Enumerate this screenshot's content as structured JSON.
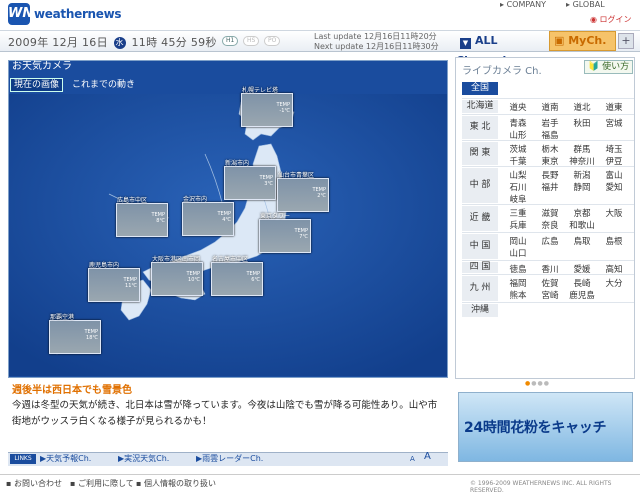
{
  "brand": {
    "logo": "WN",
    "name": "weathernews"
  },
  "top_links": {
    "company": "COMPANY",
    "global": "GLOBAL",
    "login": "ログイン"
  },
  "datebar": {
    "date": "2009年 12月 16日",
    "dow": "水",
    "time": "11時 45分 59秒",
    "pills": [
      "H1",
      "HS",
      "PO"
    ],
    "last_update": "Last update 12月16日11時20分",
    "next_update": "Next update 12月16日11時30分"
  },
  "nav": {
    "all_channel": "ALL Channel",
    "mych": "MyCh.",
    "plus": "+"
  },
  "left": {
    "title": "お天気カメラ",
    "tab_now": "現在の画像",
    "tab_past": "これまでの動き"
  },
  "cameras": [
    {
      "label": "札幌テレビ塔",
      "temp": "TEMP\n-1℃"
    },
    {
      "label": "新潟市内",
      "temp": "TEMP\n3℃"
    },
    {
      "label": "仙台市青葉区",
      "temp": "TEMP\n2℃"
    },
    {
      "label": "広島市中区",
      "temp": "TEMP\n8℃"
    },
    {
      "label": "金沢市内",
      "temp": "TEMP\n4℃"
    },
    {
      "label": "東京タワー",
      "temp": "TEMP\n7℃"
    },
    {
      "label": "大阪市港区南市岡",
      "temp": "TEMP\n10℃"
    },
    {
      "label": "名古屋市中区",
      "temp": "TEMP\n6℃"
    },
    {
      "label": "鹿児島市内",
      "temp": "TEMP\n11℃"
    },
    {
      "label": "那覇空港",
      "temp": "TEMP\n18℃"
    }
  ],
  "headline": "週後半は西日本でも雪景色",
  "desc": "今週は冬型の天気が続き、北日本は雪が降っています。今夜は山陰でも雪が降る可能性あり。山や市街地がウッスラ白くなる様子が見られるかも！",
  "links": {
    "tag": "LINKS",
    "items": [
      "天気予報Ch.",
      "実況天気Ch.",
      "雨雲レーダーCh."
    ],
    "fontA": "A",
    "fontA2": "A"
  },
  "right": {
    "title": "ライブカメラ Ch.",
    "howto": "使い方",
    "all": "全国",
    "regions": [
      {
        "name": "北海道",
        "prefs": [
          "道央",
          "道南",
          "道北",
          "道東"
        ]
      },
      {
        "name": "東 北",
        "prefs": [
          "青森",
          "岩手",
          "秋田",
          "宮城",
          "山形",
          "福島"
        ]
      },
      {
        "name": "関 東",
        "prefs": [
          "茨城",
          "栃木",
          "群馬",
          "埼玉",
          "千葉",
          "東京",
          "神奈川",
          "伊豆"
        ]
      },
      {
        "name": "中 部",
        "prefs": [
          "山梨",
          "長野",
          "新潟",
          "富山",
          "石川",
          "福井",
          "静岡",
          "愛知",
          "岐阜"
        ]
      },
      {
        "name": "近 畿",
        "prefs": [
          "三重",
          "滋賀",
          "京都",
          "大阪",
          "兵庫",
          "奈良",
          "和歌山"
        ]
      },
      {
        "name": "中 国",
        "prefs": [
          "岡山",
          "広島",
          "鳥取",
          "島根",
          "山口"
        ]
      },
      {
        "name": "四 国",
        "prefs": [
          "徳島",
          "香川",
          "愛媛",
          "高知"
        ]
      },
      {
        "name": "九 州",
        "prefs": [
          "福岡",
          "佐賀",
          "長崎",
          "大分",
          "熊本",
          "宮崎",
          "鹿児島"
        ]
      },
      {
        "name": "沖縄",
        "prefs": []
      }
    ]
  },
  "ad": {
    "text": "24時間花粉をキャッチ"
  },
  "footer": {
    "links": [
      "お問い合わせ",
      "ご利用に際して",
      "個人情報の取り扱い"
    ],
    "copyright": "© 1996-2009 WEATHERNEWS INC. ALL RIGHTS RESERVED."
  },
  "colors": {
    "brand_blue": "#1a55b0",
    "panel_blue": "#1a4c9e",
    "accent_orange": "#e07000"
  }
}
